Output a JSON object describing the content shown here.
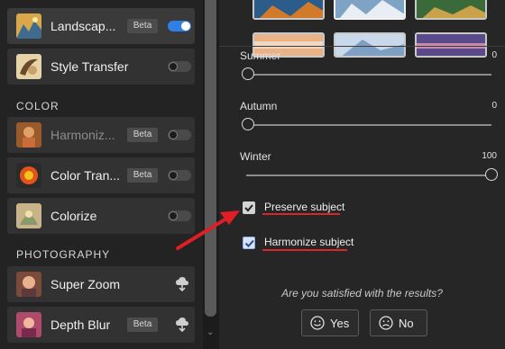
{
  "filters_panel": {
    "items": [
      {
        "label": "Landscap...",
        "badge": "Beta",
        "toggle": "on",
        "active": true
      },
      {
        "label": "Style Transfer",
        "toggle": "off"
      },
      {
        "label": "Harmoniz...",
        "badge": "Beta",
        "toggle": "off",
        "dimmed": true
      },
      {
        "label": "Color Tran...",
        "badge": "Beta",
        "toggle": "off"
      },
      {
        "label": "Colorize",
        "toggle": "off"
      },
      {
        "label": "Super Zoom",
        "action": "cloud-download-icon"
      },
      {
        "label": "Depth Blur",
        "badge": "Beta",
        "action": "cloud-download-icon"
      }
    ],
    "sections": {
      "color": "COLOR",
      "photography": "PHOTOGRAPHY"
    }
  },
  "settings": {
    "sliders": [
      {
        "label": "Summer",
        "value_text": "0",
        "level": 0
      },
      {
        "label": "Autumn",
        "value_text": "0",
        "level": 0
      },
      {
        "label": "Winter",
        "value_text": "100",
        "level": 1
      }
    ],
    "checkboxes": [
      {
        "label": "Preserve subject",
        "checked": true
      },
      {
        "label": "Harmonize subject",
        "checked": true
      }
    ],
    "feedback": {
      "question": "Are you satisfied with the results?",
      "yes_label": "Yes",
      "no_label": "No"
    }
  },
  "colors": {
    "toggle_on": "#2f7fe4",
    "annotation_red": "#d9262a"
  }
}
